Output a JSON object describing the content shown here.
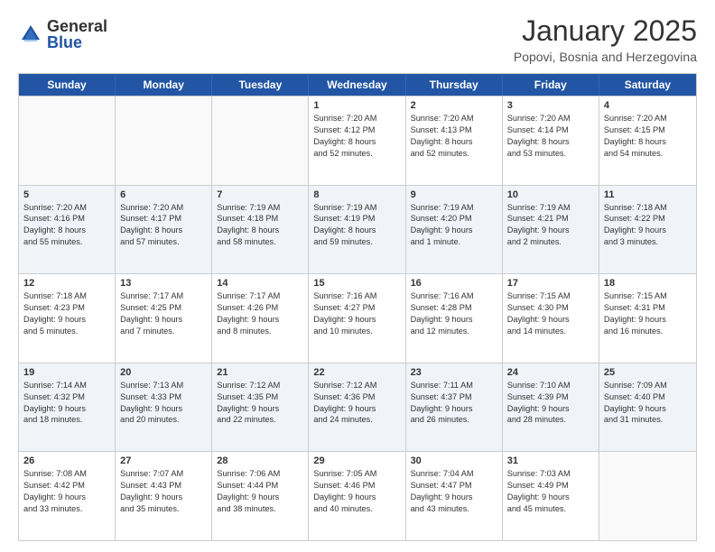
{
  "logo": {
    "general": "General",
    "blue": "Blue"
  },
  "title": "January 2025",
  "subtitle": "Popovi, Bosnia and Herzegovina",
  "header_days": [
    "Sunday",
    "Monday",
    "Tuesday",
    "Wednesday",
    "Thursday",
    "Friday",
    "Saturday"
  ],
  "weeks": [
    [
      {
        "day": "",
        "info": ""
      },
      {
        "day": "",
        "info": ""
      },
      {
        "day": "",
        "info": ""
      },
      {
        "day": "1",
        "info": "Sunrise: 7:20 AM\nSunset: 4:12 PM\nDaylight: 8 hours\nand 52 minutes."
      },
      {
        "day": "2",
        "info": "Sunrise: 7:20 AM\nSunset: 4:13 PM\nDaylight: 8 hours\nand 52 minutes."
      },
      {
        "day": "3",
        "info": "Sunrise: 7:20 AM\nSunset: 4:14 PM\nDaylight: 8 hours\nand 53 minutes."
      },
      {
        "day": "4",
        "info": "Sunrise: 7:20 AM\nSunset: 4:15 PM\nDaylight: 8 hours\nand 54 minutes."
      }
    ],
    [
      {
        "day": "5",
        "info": "Sunrise: 7:20 AM\nSunset: 4:16 PM\nDaylight: 8 hours\nand 55 minutes."
      },
      {
        "day": "6",
        "info": "Sunrise: 7:20 AM\nSunset: 4:17 PM\nDaylight: 8 hours\nand 57 minutes."
      },
      {
        "day": "7",
        "info": "Sunrise: 7:19 AM\nSunset: 4:18 PM\nDaylight: 8 hours\nand 58 minutes."
      },
      {
        "day": "8",
        "info": "Sunrise: 7:19 AM\nSunset: 4:19 PM\nDaylight: 8 hours\nand 59 minutes."
      },
      {
        "day": "9",
        "info": "Sunrise: 7:19 AM\nSunset: 4:20 PM\nDaylight: 9 hours\nand 1 minute."
      },
      {
        "day": "10",
        "info": "Sunrise: 7:19 AM\nSunset: 4:21 PM\nDaylight: 9 hours\nand 2 minutes."
      },
      {
        "day": "11",
        "info": "Sunrise: 7:18 AM\nSunset: 4:22 PM\nDaylight: 9 hours\nand 3 minutes."
      }
    ],
    [
      {
        "day": "12",
        "info": "Sunrise: 7:18 AM\nSunset: 4:23 PM\nDaylight: 9 hours\nand 5 minutes."
      },
      {
        "day": "13",
        "info": "Sunrise: 7:17 AM\nSunset: 4:25 PM\nDaylight: 9 hours\nand 7 minutes."
      },
      {
        "day": "14",
        "info": "Sunrise: 7:17 AM\nSunset: 4:26 PM\nDaylight: 9 hours\nand 8 minutes."
      },
      {
        "day": "15",
        "info": "Sunrise: 7:16 AM\nSunset: 4:27 PM\nDaylight: 9 hours\nand 10 minutes."
      },
      {
        "day": "16",
        "info": "Sunrise: 7:16 AM\nSunset: 4:28 PM\nDaylight: 9 hours\nand 12 minutes."
      },
      {
        "day": "17",
        "info": "Sunrise: 7:15 AM\nSunset: 4:30 PM\nDaylight: 9 hours\nand 14 minutes."
      },
      {
        "day": "18",
        "info": "Sunrise: 7:15 AM\nSunset: 4:31 PM\nDaylight: 9 hours\nand 16 minutes."
      }
    ],
    [
      {
        "day": "19",
        "info": "Sunrise: 7:14 AM\nSunset: 4:32 PM\nDaylight: 9 hours\nand 18 minutes."
      },
      {
        "day": "20",
        "info": "Sunrise: 7:13 AM\nSunset: 4:33 PM\nDaylight: 9 hours\nand 20 minutes."
      },
      {
        "day": "21",
        "info": "Sunrise: 7:12 AM\nSunset: 4:35 PM\nDaylight: 9 hours\nand 22 minutes."
      },
      {
        "day": "22",
        "info": "Sunrise: 7:12 AM\nSunset: 4:36 PM\nDaylight: 9 hours\nand 24 minutes."
      },
      {
        "day": "23",
        "info": "Sunrise: 7:11 AM\nSunset: 4:37 PM\nDaylight: 9 hours\nand 26 minutes."
      },
      {
        "day": "24",
        "info": "Sunrise: 7:10 AM\nSunset: 4:39 PM\nDaylight: 9 hours\nand 28 minutes."
      },
      {
        "day": "25",
        "info": "Sunrise: 7:09 AM\nSunset: 4:40 PM\nDaylight: 9 hours\nand 31 minutes."
      }
    ],
    [
      {
        "day": "26",
        "info": "Sunrise: 7:08 AM\nSunset: 4:42 PM\nDaylight: 9 hours\nand 33 minutes."
      },
      {
        "day": "27",
        "info": "Sunrise: 7:07 AM\nSunset: 4:43 PM\nDaylight: 9 hours\nand 35 minutes."
      },
      {
        "day": "28",
        "info": "Sunrise: 7:06 AM\nSunset: 4:44 PM\nDaylight: 9 hours\nand 38 minutes."
      },
      {
        "day": "29",
        "info": "Sunrise: 7:05 AM\nSunset: 4:46 PM\nDaylight: 9 hours\nand 40 minutes."
      },
      {
        "day": "30",
        "info": "Sunrise: 7:04 AM\nSunset: 4:47 PM\nDaylight: 9 hours\nand 43 minutes."
      },
      {
        "day": "31",
        "info": "Sunrise: 7:03 AM\nSunset: 4:49 PM\nDaylight: 9 hours\nand 45 minutes."
      },
      {
        "day": "",
        "info": ""
      }
    ]
  ]
}
